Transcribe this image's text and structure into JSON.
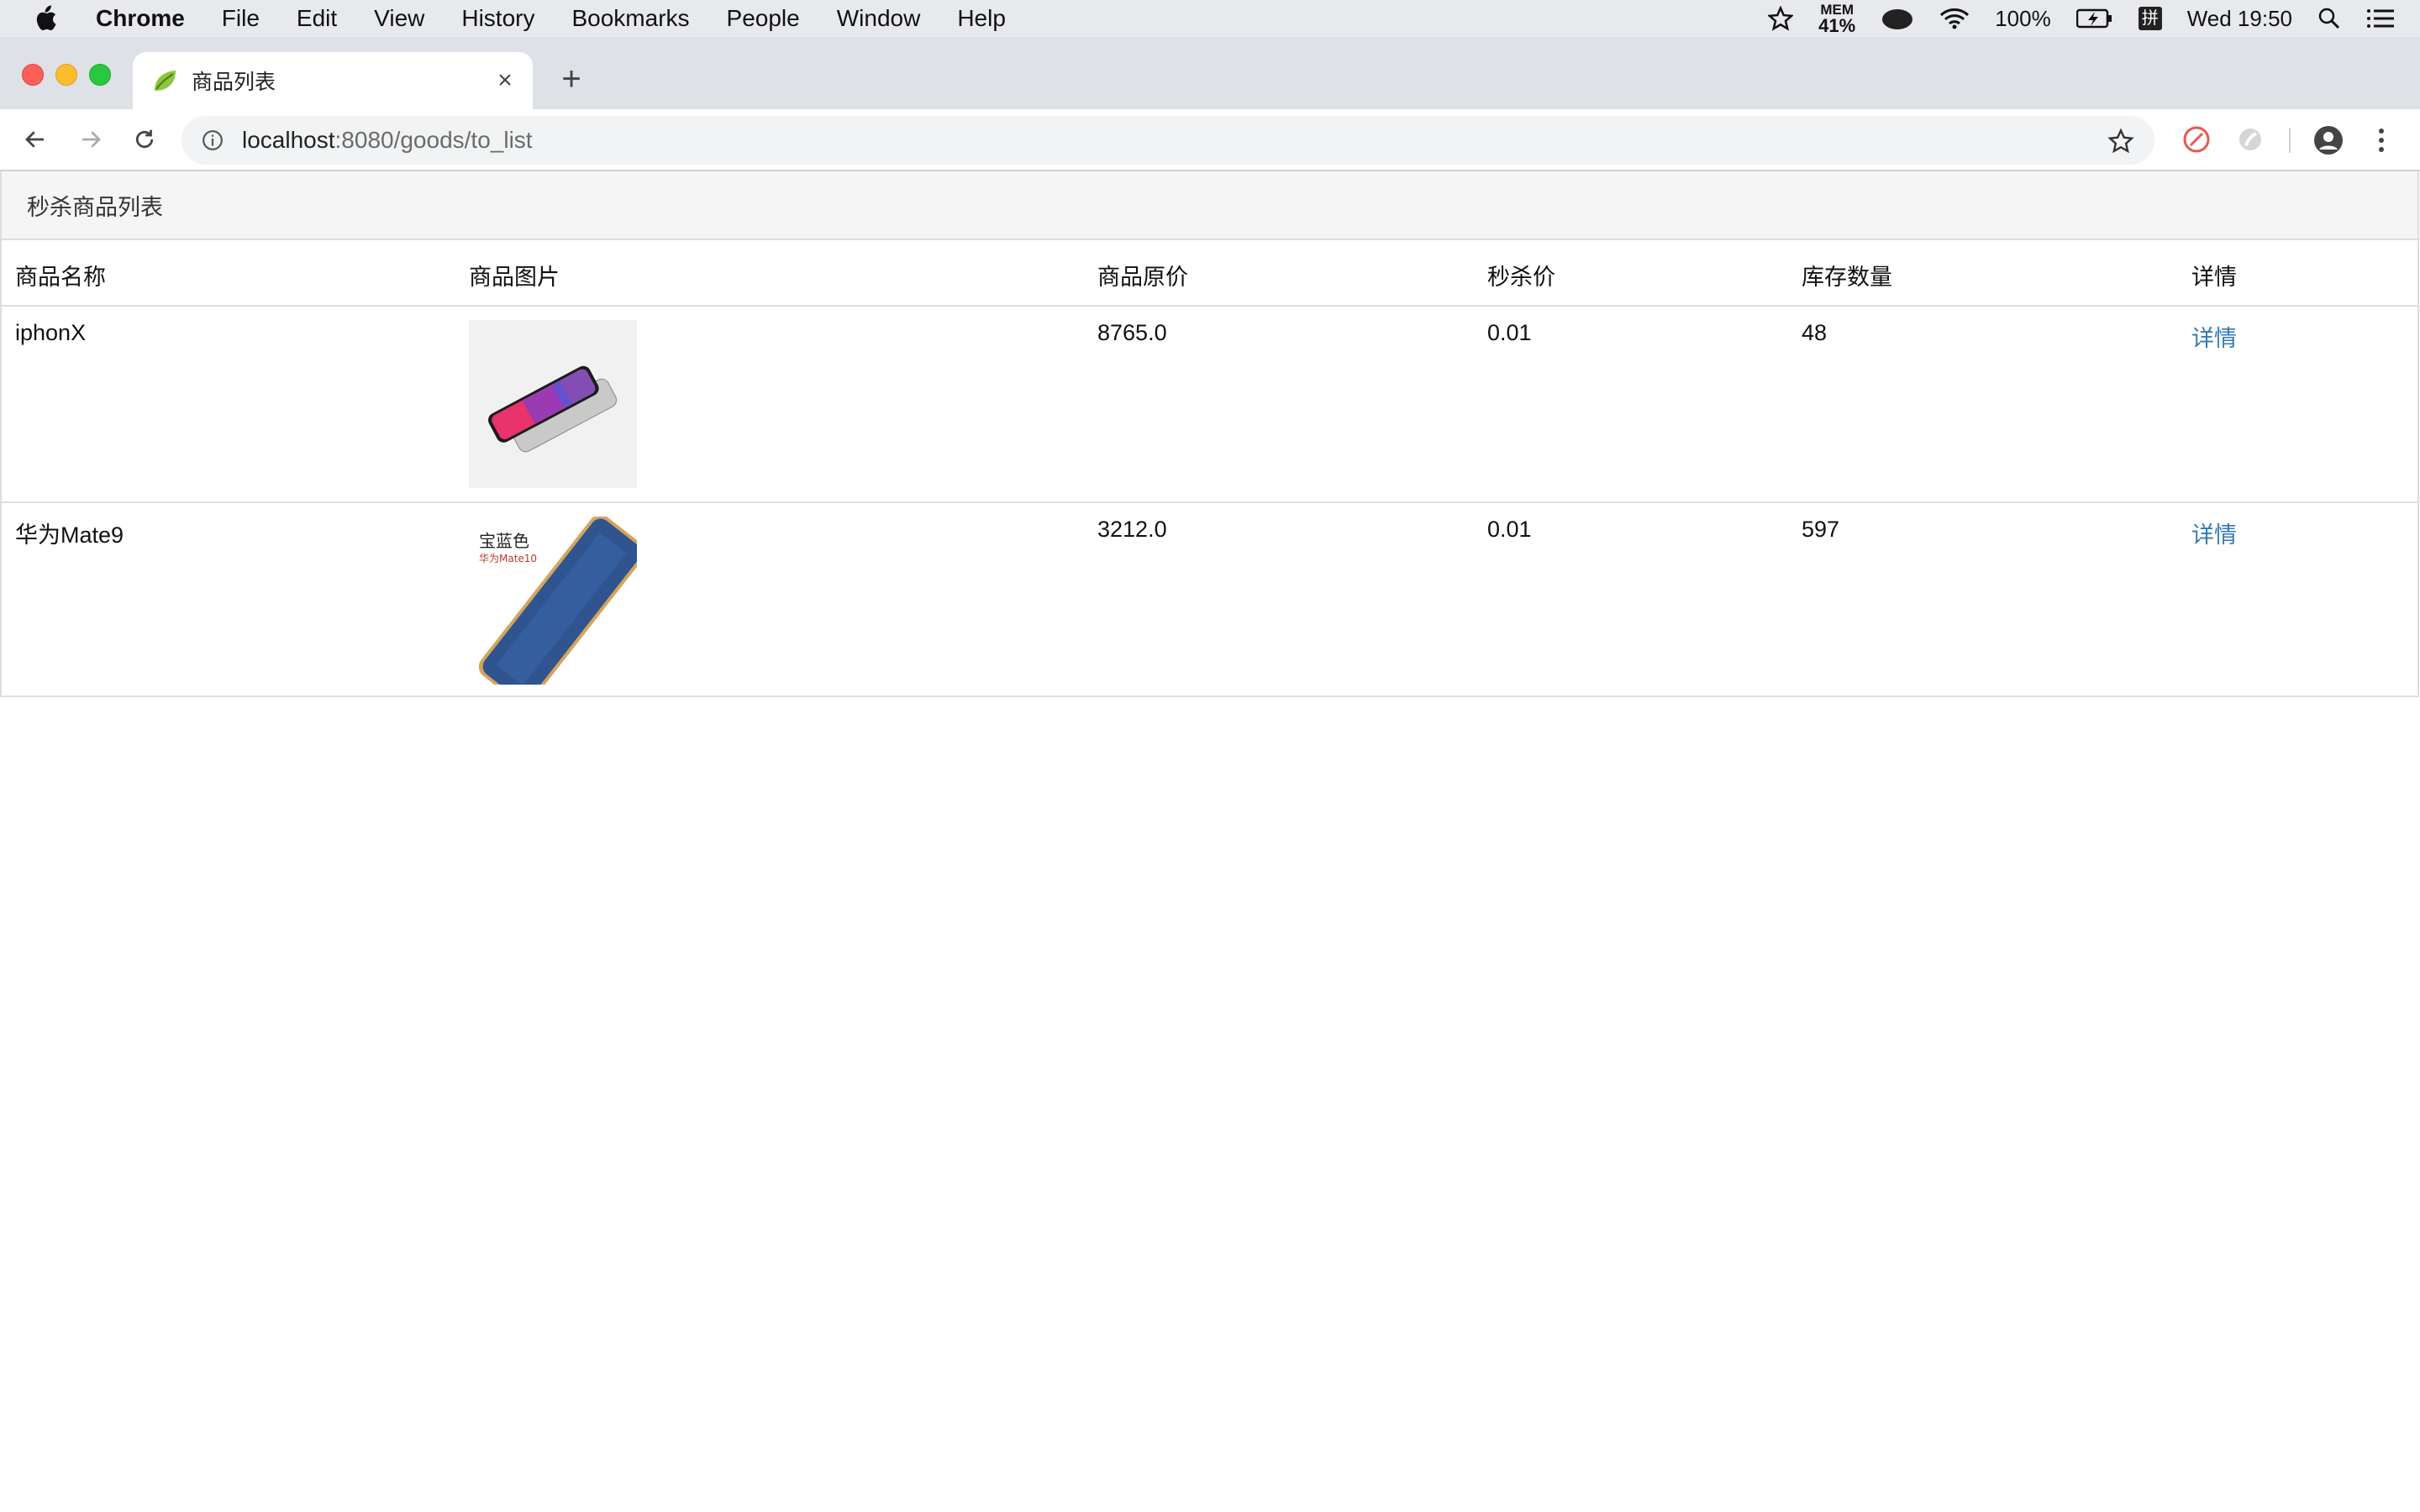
{
  "menubar": {
    "app_name": "Chrome",
    "items": [
      "File",
      "Edit",
      "View",
      "History",
      "Bookmarks",
      "People",
      "Window",
      "Help"
    ],
    "mem_label": "MEM",
    "mem_value": "41%",
    "battery": "100%",
    "ime": "拼",
    "clock": "Wed 19:50"
  },
  "tab": {
    "title": "商品列表",
    "close": "×",
    "new_tab": "+"
  },
  "address_bar": {
    "host": "localhost",
    "path": ":8080/goods/to_list"
  },
  "panel": {
    "heading": "秒杀商品列表",
    "columns": [
      "商品名称",
      "商品图片",
      "商品原价",
      "秒杀价",
      "库存数量",
      "详情"
    ],
    "rows": [
      {
        "name": "iphonX",
        "image": "iphone-x-product-photo",
        "price": "8765.0",
        "seckill_price": "0.01",
        "stock": "48",
        "detail": "详情"
      },
      {
        "name": "华为Mate9",
        "image": "huawei-mate-blue-product-photo",
        "image_caption_1": "宝蓝色",
        "image_caption_2": "华为Mate10",
        "price": "3212.0",
        "seckill_price": "0.01",
        "stock": "597",
        "detail": "详情"
      }
    ]
  },
  "colors": {
    "link": "#337ab7",
    "panel_heading_bg": "#f5f5f5",
    "border": "#dddddd",
    "tabstrip_bg": "#dee1e6"
  }
}
